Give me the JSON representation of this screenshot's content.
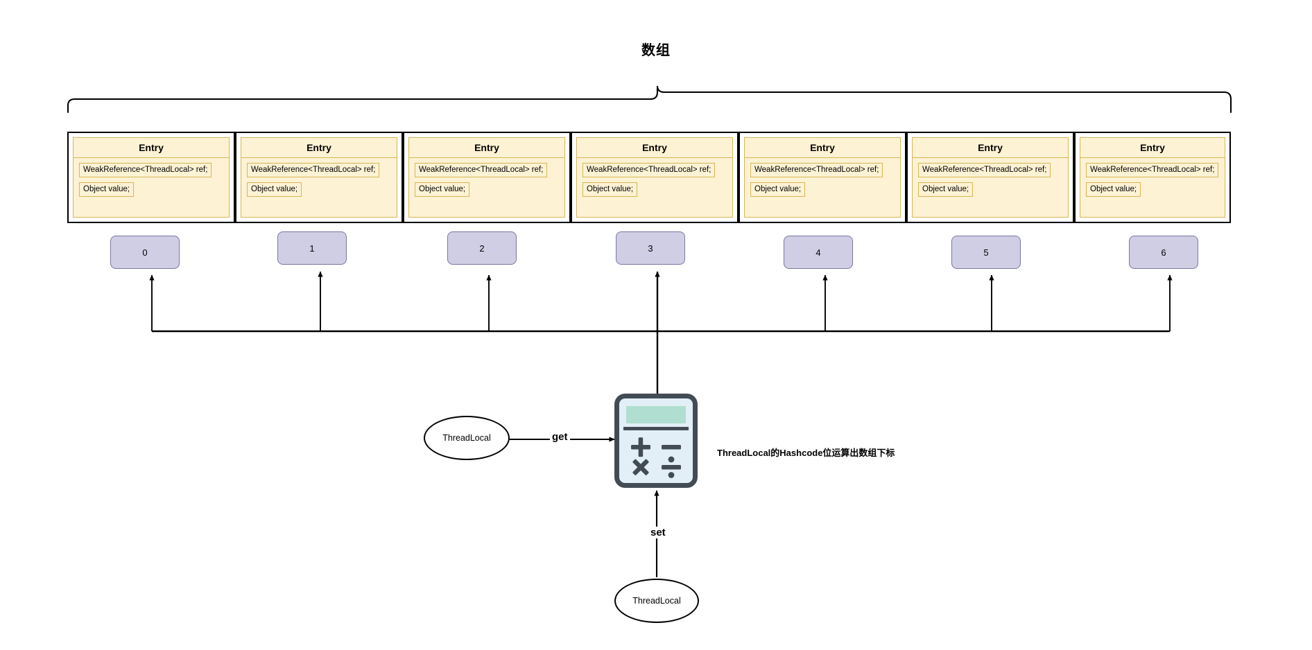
{
  "title": "数组",
  "entries": [
    {
      "header": "Entry",
      "field_ref": "WeakReference<ThreadLocal> ref;",
      "field_value": "Object value;"
    },
    {
      "header": "Entry",
      "field_ref": "WeakReference<ThreadLocal> ref;",
      "field_value": "Object value;"
    },
    {
      "header": "Entry",
      "field_ref": "WeakReference<ThreadLocal> ref;",
      "field_value": "Object value;"
    },
    {
      "header": "Entry",
      "field_ref": "WeakReference<ThreadLocal> ref;",
      "field_value": "Object value;"
    },
    {
      "header": "Entry",
      "field_ref": "WeakReference<ThreadLocal> ref;",
      "field_value": "Object value;"
    },
    {
      "header": "Entry",
      "field_ref": "WeakReference<ThreadLocal> ref;",
      "field_value": "Object value;"
    },
    {
      "header": "Entry",
      "field_ref": "WeakReference<ThreadLocal> ref;",
      "field_value": "Object value;"
    }
  ],
  "indices": [
    {
      "label": "0"
    },
    {
      "label": "1"
    },
    {
      "label": "2"
    },
    {
      "label": "3"
    },
    {
      "label": "4"
    },
    {
      "label": "5"
    },
    {
      "label": "6"
    }
  ],
  "nodes": {
    "threadlocal_get": "ThreadLocal",
    "threadlocal_set": "ThreadLocal"
  },
  "edges": {
    "get_label": "get",
    "set_label": "set"
  },
  "note": "ThreadLocal的Hashcode位运算出数组下标",
  "icons": {
    "calculator": "calculator-icon",
    "brace": "curly-brace"
  },
  "colors": {
    "entry_fill": "#fdf2d4",
    "entry_border": "#d6b656",
    "entry_outer_border": "#000000",
    "index_fill": "#cfcee4",
    "index_border": "#7a76a3",
    "calculator_frame": "#434c55",
    "calculator_display": "#b0ded0",
    "calculator_body": "#e3eff7",
    "line": "#000000",
    "background": "#ffffff"
  }
}
